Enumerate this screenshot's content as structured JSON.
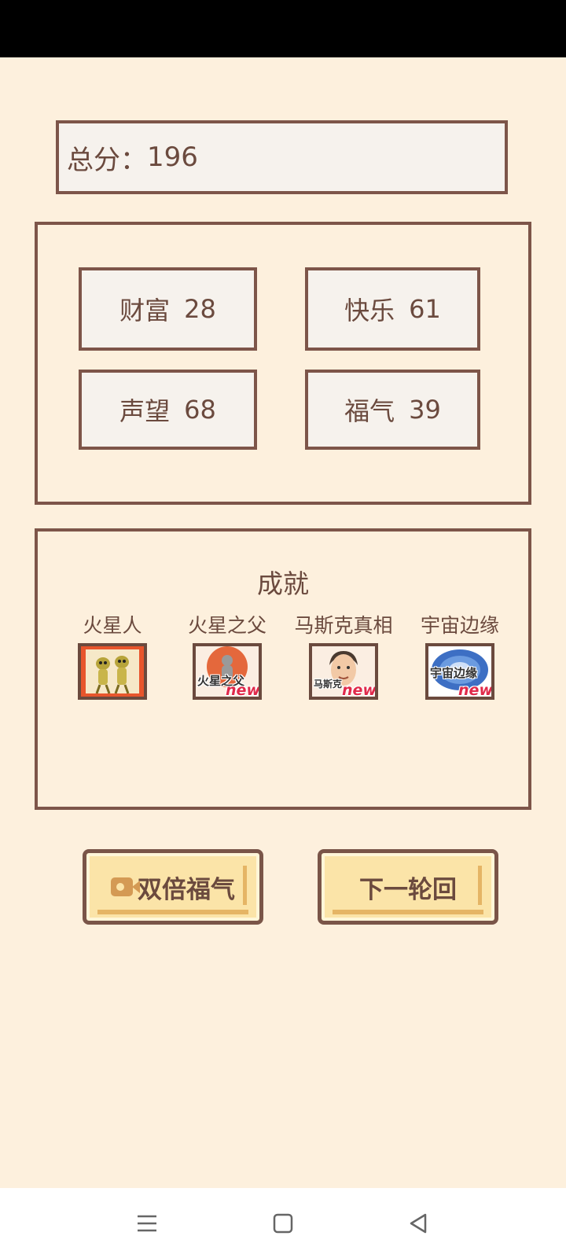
{
  "total": {
    "label": "总分：",
    "value": "196"
  },
  "stats": [
    {
      "name": "财富",
      "value": "28"
    },
    {
      "name": "快乐",
      "value": "61"
    },
    {
      "name": "声望",
      "value": "68"
    },
    {
      "name": "福气",
      "value": "39"
    }
  ],
  "achievements": {
    "title": "成就",
    "items": [
      {
        "label": "火星人",
        "icon": "martians-icon",
        "is_new": false
      },
      {
        "label": "火星之父",
        "icon": "mars-father-icon",
        "caption": "火星之父",
        "is_new": true,
        "badge": "new"
      },
      {
        "label": "马斯克真相",
        "icon": "musk-portrait-icon",
        "caption": "马斯克",
        "is_new": true,
        "badge": "new"
      },
      {
        "label": "宇宙边缘",
        "icon": "universe-edge-icon",
        "caption": "宇宙边缘",
        "is_new": true,
        "badge": "new"
      }
    ]
  },
  "buttons": {
    "double_luck": "双倍福气",
    "next_round": "下一轮回"
  },
  "nav": {
    "icons": [
      "menu-icon",
      "home-square-icon",
      "back-triangle-icon"
    ]
  },
  "colors": {
    "background": "#fdf0dd",
    "border": "#7d5549",
    "box_fill": "#f6f2ed",
    "text": "#6b4a3e",
    "button_fill": "#fbe4a8",
    "new_badge": "#e0294a"
  }
}
